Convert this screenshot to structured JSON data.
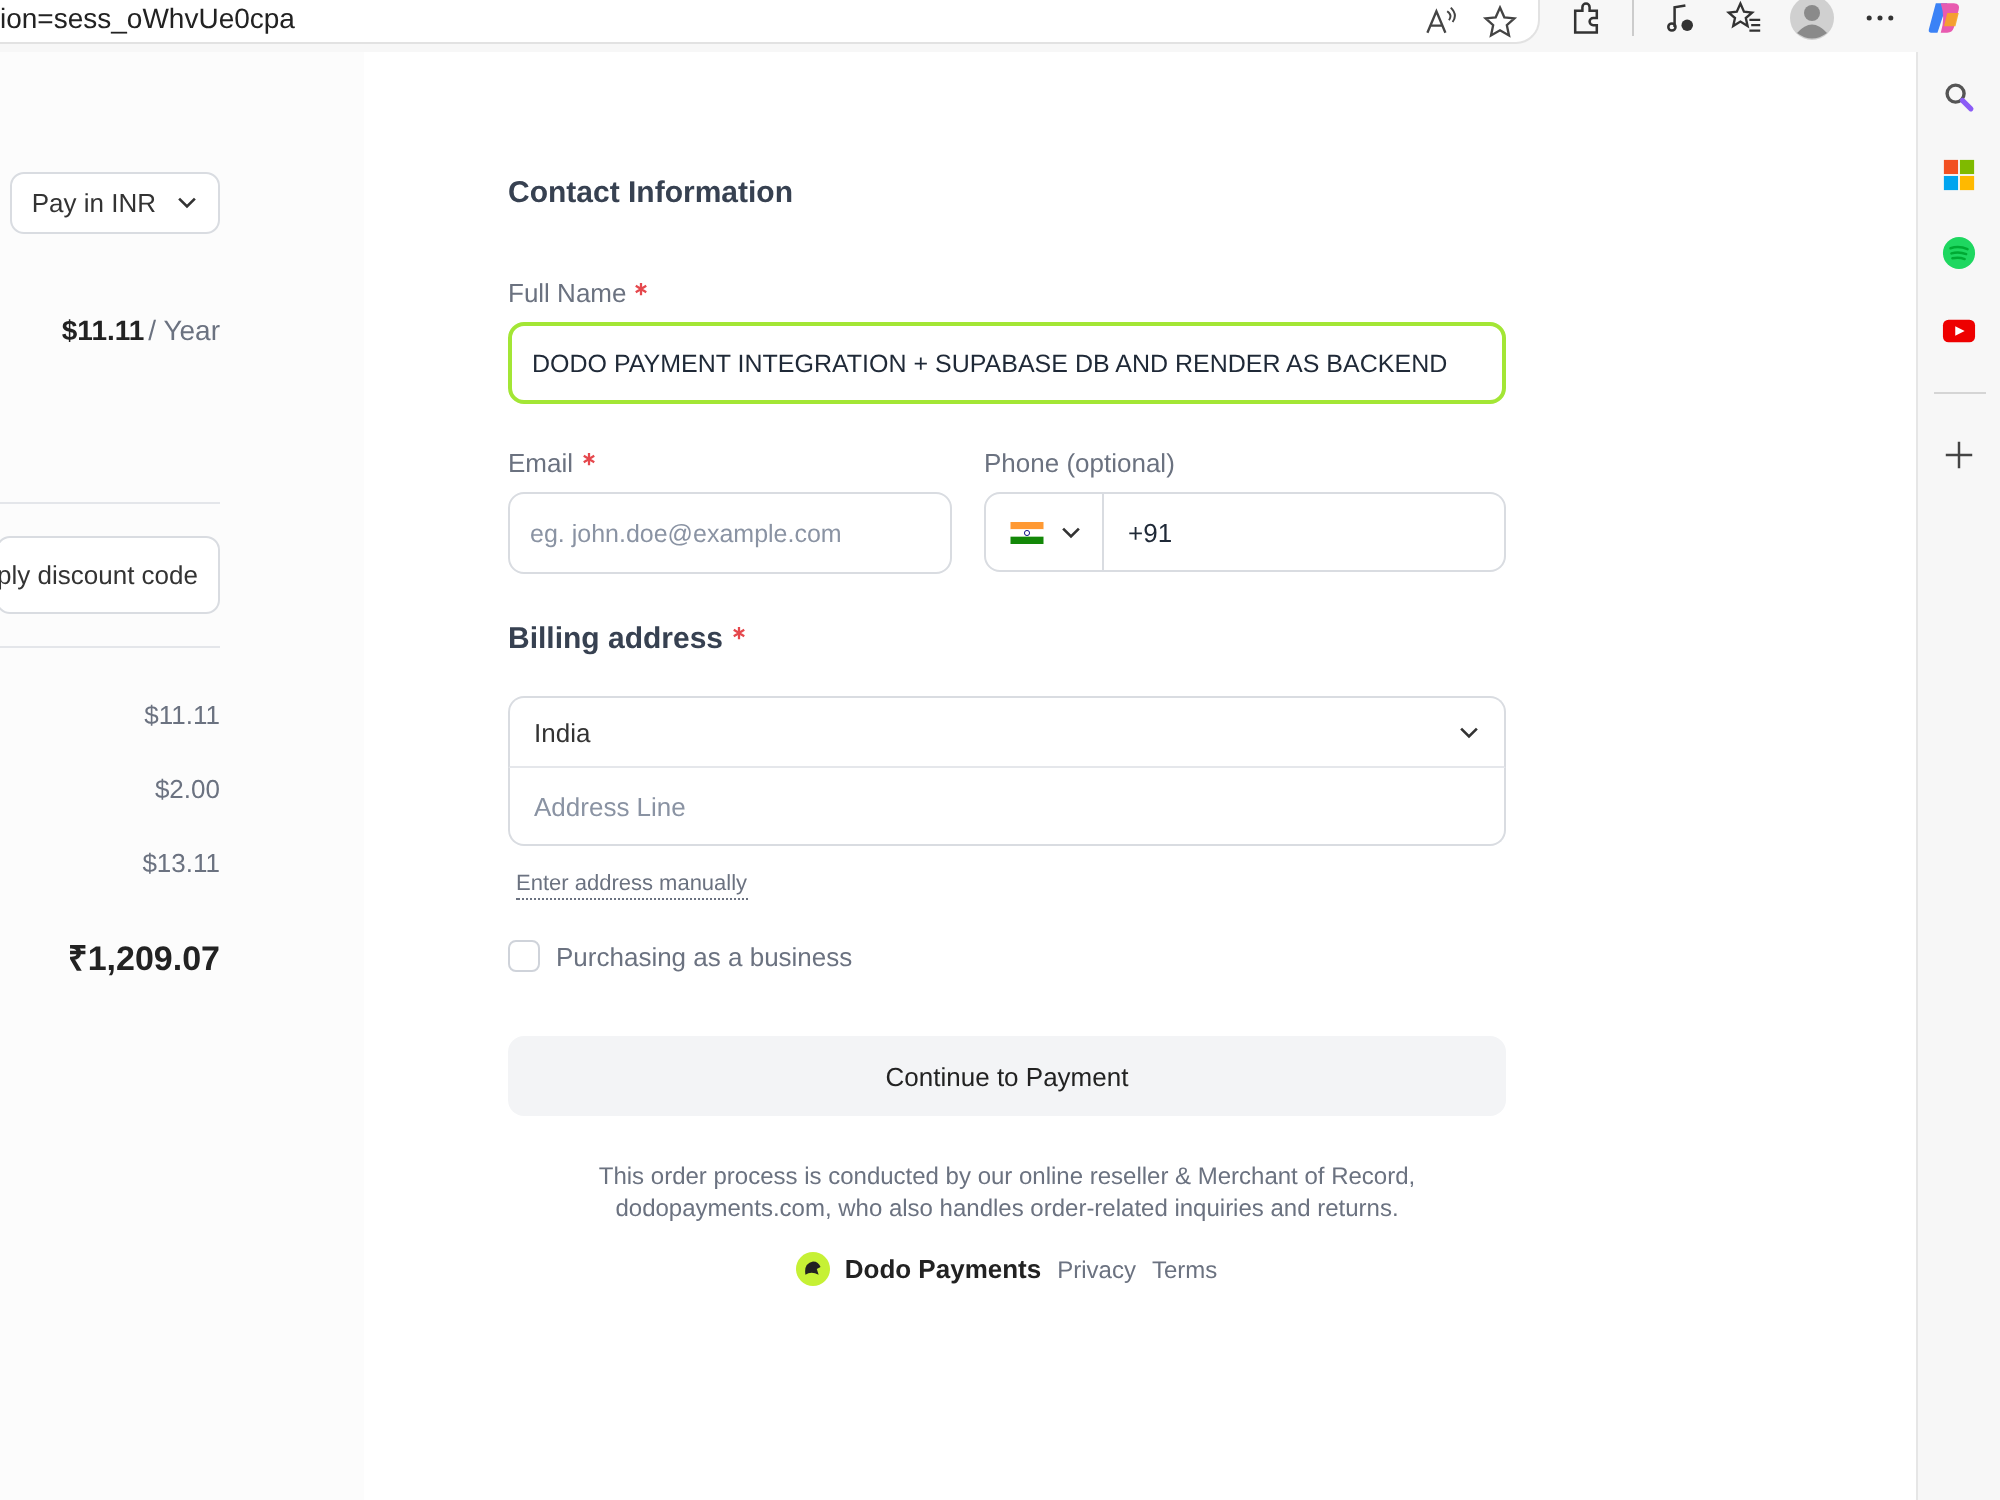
{
  "browser": {
    "address": "ion=sess_oWhvUe0cpa"
  },
  "summary": {
    "currency_button": "Pay in INR",
    "price": "$11.11",
    "period": "/ Year",
    "discount_button": "ply discount code",
    "amounts": [
      "$11.11",
      "$2.00",
      "$13.11"
    ],
    "total": "₹1,209.07"
  },
  "form": {
    "section_title": "Contact Information",
    "full_name": {
      "label": "Full Name",
      "required": true,
      "value": "DODO PAYMENT INTEGRATION + SUPABASE DB AND RENDER AS BACKEND",
      "focused": true
    },
    "email": {
      "label": "Email",
      "required": true,
      "placeholder": "eg. john.doe@example.com"
    },
    "phone": {
      "label": "Phone (optional)",
      "value": "+91"
    },
    "billing": {
      "title": "Billing address",
      "required": true,
      "country": "India",
      "address_placeholder": "Address Line",
      "manual_link": "Enter address manually"
    },
    "business": {
      "label": "Purchasing as a business",
      "checked": false
    },
    "submit": "Continue to Payment",
    "disclaimer": "This order process is conducted by our online reseller & Merchant of Record, dodopayments.com, who also handles order-related inquiries and returns.",
    "brand": "Dodo Payments",
    "links": [
      "Privacy",
      "Terms"
    ]
  }
}
